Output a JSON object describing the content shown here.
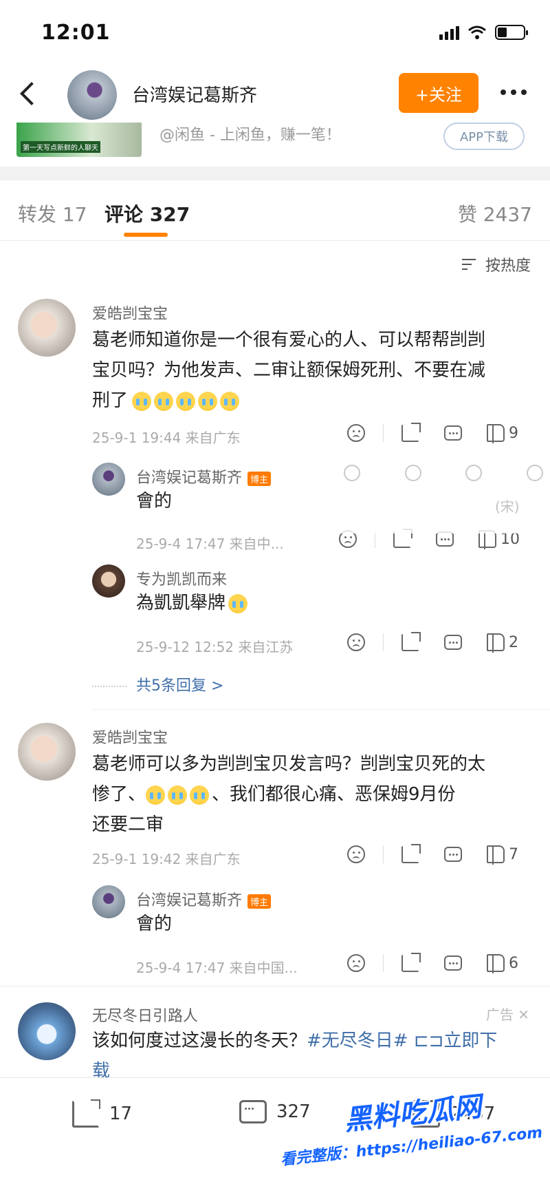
{
  "status": {
    "time": "12:01"
  },
  "header": {
    "name": "台湾娱记葛斯齐",
    "follow_label": "+关注"
  },
  "ad_strip": {
    "thumb_text": "第一天写点新鲜的人聊天",
    "tagline": "@闲鱼 - 上闲鱼，赚一笔！",
    "app_button": "APP下载"
  },
  "tabs": {
    "repost": "转发 17",
    "comment": "评论 327",
    "likes": "赞 2437"
  },
  "sort": {
    "label": "按热度"
  },
  "comments": [
    {
      "name": "爱皓剀宝宝",
      "text_line1": "葛老师知道你是一个很有爱心的人、可以帮帮剀剀",
      "text_line2": "宝贝吗？为他发声、二审让额保姆死刑、不要在减",
      "text_line3": "刑了",
      "meta": "25-9-1 19:44 来自广东",
      "likes": "9",
      "replies": [
        {
          "name": "台湾娱记葛斯齐",
          "badge": "博主",
          "text": "會的",
          "meta": "25-9-4 17:47 来自中...",
          "likes": "10"
        },
        {
          "name": "专为凯凯而来",
          "text": "為凱凱舉牌",
          "meta": "25-9-12 12:52 来自江苏",
          "likes": "2"
        }
      ],
      "more_replies": "共5条回复 >"
    },
    {
      "name": "爱皓剀宝宝",
      "text_line1": "葛老师可以多为剀剀宝贝发言吗？剀剀宝贝死的太",
      "text_line2_a": "惨了、",
      "text_line2_b": "、我们都很心痛、恶保姆9月份",
      "text_line3": "还要二审",
      "meta": "25-9-1 19:42 来自广东",
      "likes": "7",
      "replies": [
        {
          "name": "台湾娱记葛斯齐",
          "badge": "博主",
          "text": "會的",
          "meta": "25-9-4 17:47 来自中国...",
          "likes": "6"
        }
      ]
    }
  ],
  "ad_comment": {
    "name": "无尽冬日引路人",
    "label": "广告 ✕",
    "text_a": "该如何度过这漫长的冬天？",
    "text_link": "#无尽冬日# ⊏⊐立即下",
    "text_b": "载"
  },
  "overlay_ghost": {
    "text": "(宋)"
  },
  "bottom_bar": {
    "share_count": "17",
    "comment_count": "327",
    "like_count": "2437"
  },
  "watermark": {
    "main": "黑料吃瓜网",
    "url": "看完整版：https://heiliao-67.com"
  },
  "colors": {
    "accent": "#ff8200",
    "link": "#3f6ea8"
  }
}
